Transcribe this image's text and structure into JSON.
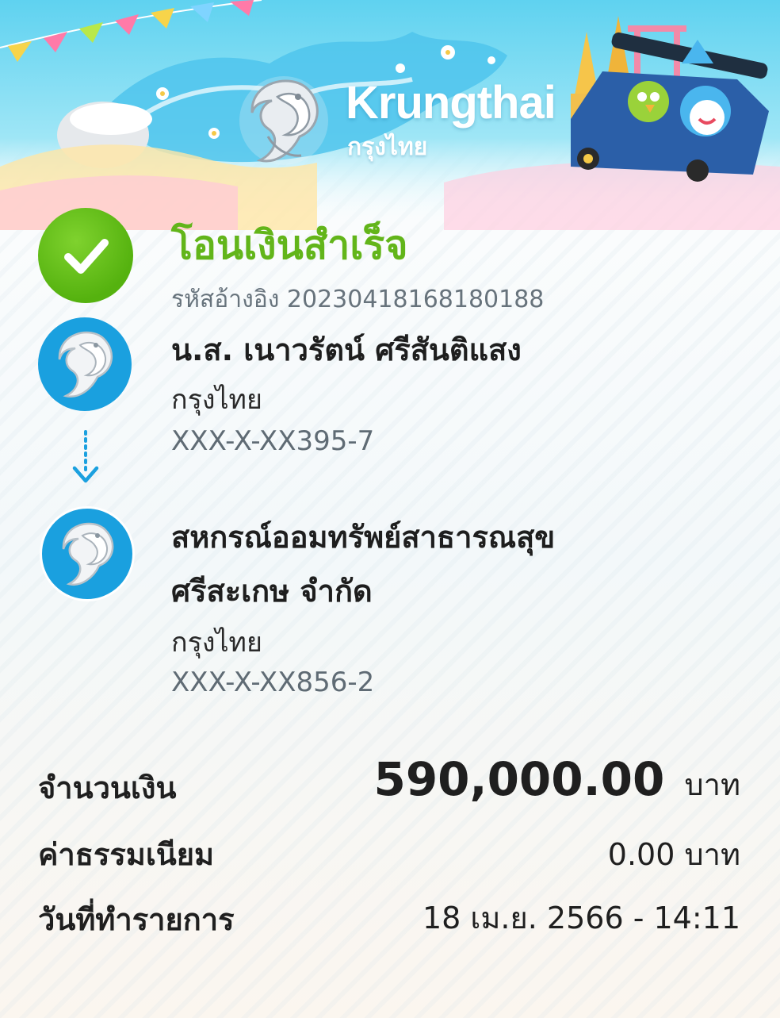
{
  "brand": {
    "name_en": "Krungthai",
    "name_th": "กรุงไทย"
  },
  "status": {
    "title": "โอนเงินสำเร็จ",
    "reference": "รหัสอ้างอิง 20230418168180188"
  },
  "sender": {
    "name": "น.ส. เนาวรัตน์ ศรีสันติแสง",
    "bank": "กรุงไทย",
    "account": "XXX-X-XX395-7"
  },
  "receiver": {
    "name_line1": "สหกรณ์ออมทรัพย์สาธารณสุข",
    "name_line2": "ศรีสะเกษ จำกัด",
    "bank": "กรุงไทย",
    "account": "XXX-X-XX856-2"
  },
  "details": {
    "amount_label": "จำนวนเงิน",
    "amount_value": "590,000.00",
    "amount_unit": "บาท",
    "fee_label": "ค่าธรรมเนียม",
    "fee_value": "0.00 บาท",
    "date_label": "วันที่ทำรายการ",
    "date_value": "18 เม.ย. 2566 - 14:11"
  },
  "colors": {
    "success_green": "#62b51a",
    "bank_blue": "#1aa0df",
    "header_sky": "#7fdcf3"
  },
  "icons": {
    "success": "check-icon",
    "bank": "krungthai-bird-logo",
    "flow": "arrow-down-icon"
  }
}
